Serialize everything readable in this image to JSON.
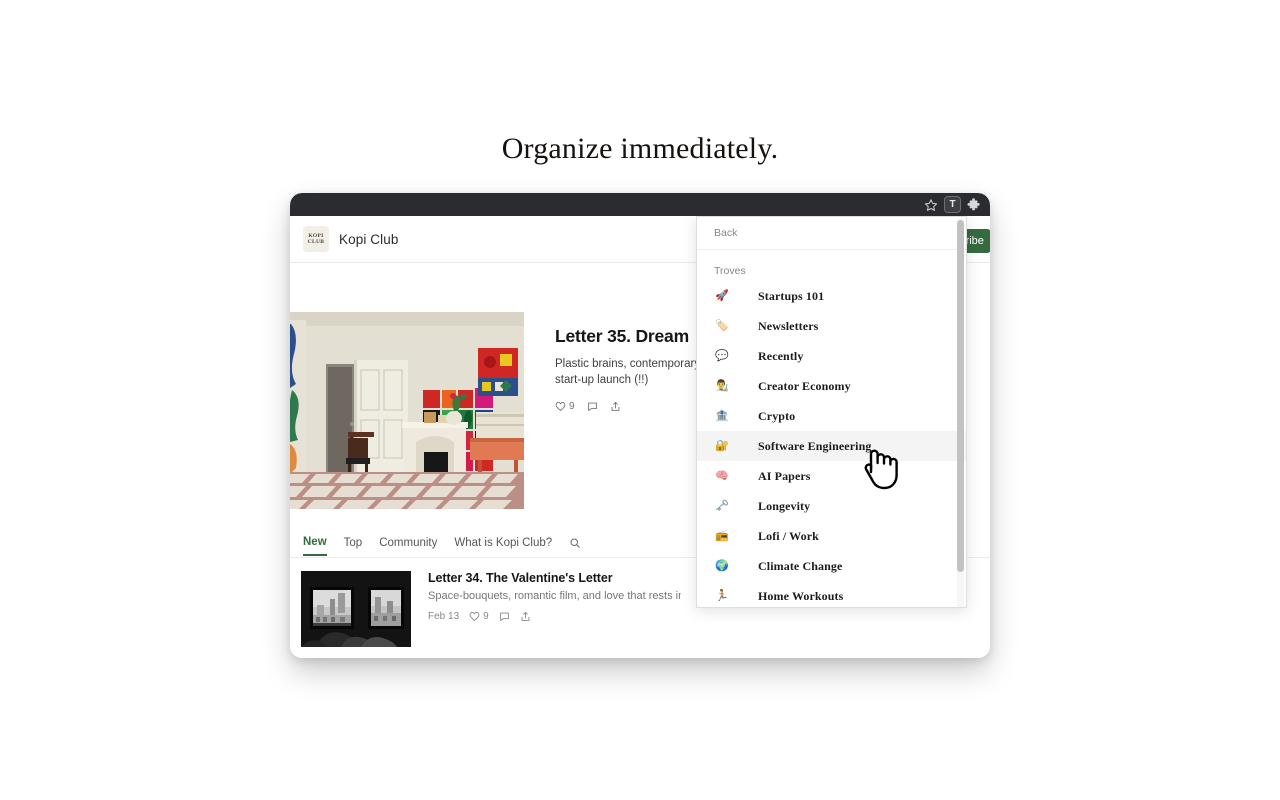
{
  "page": {
    "headline": "Organize immediately."
  },
  "browser": {
    "chrome": {
      "star_icon": "star-icon",
      "badge_label": "T",
      "extensions_icon": "puzzle-piece-icon"
    }
  },
  "site": {
    "brand": {
      "logo_line1": "KOPI",
      "logo_line2": "CLUB",
      "name": "Kopi Club"
    },
    "subscribe_label": "Subscribe",
    "accent_color": "#356b3f"
  },
  "hero": {
    "title": "Letter 35. Dream",
    "subtitle": "Plastic brains, contemporary  start-up launch (!!)",
    "subtitle_line1": "Plastic brains, contemporary",
    "subtitle_line2": "start-up launch (!!)",
    "likes": "9",
    "image_alt": "room-interior-photo"
  },
  "tabs": [
    {
      "label": "New",
      "active": true
    },
    {
      "label": "Top",
      "active": false
    },
    {
      "label": "Community",
      "active": false
    },
    {
      "label": "What is Kopi Club?",
      "active": false
    }
  ],
  "search": {
    "icon": "search-icon"
  },
  "articles": [
    {
      "title": "Letter 34. The Valentine's Letter",
      "subtitle": "Space-bouquets, romantic film, and love that rests in ord",
      "date": "Feb 13",
      "likes": "9",
      "image_alt": "two-windows-city-view-bw-photo"
    }
  ],
  "panel": {
    "back_label": "Back",
    "section_label": "Troves",
    "items": [
      {
        "icon": "🚀",
        "icon_name": "rocket-icon",
        "label": "Startups 101",
        "selected": false
      },
      {
        "icon": "🏷️",
        "icon_name": "label-tag-icon",
        "label": "Newsletters",
        "selected": false
      },
      {
        "icon": "💬",
        "icon_name": "speech-bubble-icon",
        "label": "Recently",
        "selected": false
      },
      {
        "icon": "👨‍🎨",
        "icon_name": "artist-person-icon",
        "label": "Creator Economy",
        "selected": false
      },
      {
        "icon": "🏦",
        "icon_name": "bank-icon",
        "label": "Crypto",
        "selected": false
      },
      {
        "icon": "🔐",
        "icon_name": "lock-icon",
        "label": "Software Engineering",
        "selected": true
      },
      {
        "icon": "🧠",
        "icon_name": "brain-icon",
        "label": "AI Papers",
        "selected": false
      },
      {
        "icon": "🗝️",
        "icon_name": "key-icon",
        "label": "Longevity",
        "selected": false
      },
      {
        "icon": "📻",
        "icon_name": "radio-icon",
        "label": "Lofi / Work",
        "selected": false
      },
      {
        "icon": "🌍",
        "icon_name": "globe-icon",
        "label": "Climate Change",
        "selected": false
      },
      {
        "icon": "🏃",
        "icon_name": "runner-icon",
        "label": "Home Workouts",
        "selected": false
      }
    ]
  },
  "cursor": {
    "type": "pointing-hand-cursor"
  }
}
